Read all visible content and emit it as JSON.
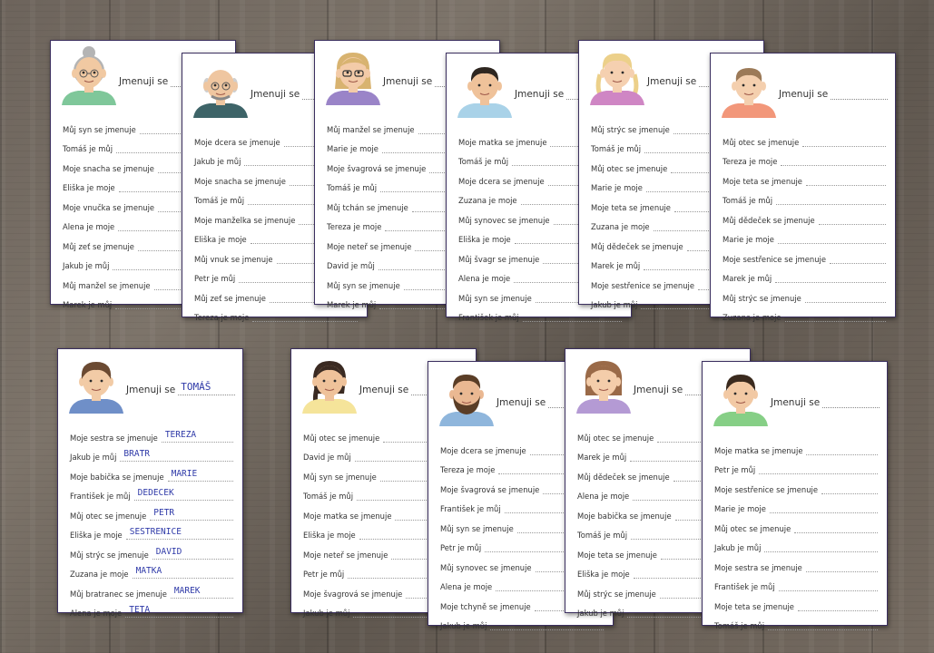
{
  "cards": [
    {
      "person": "grandmother",
      "name_label": "Jmenuji se",
      "name_answer": "",
      "shirt_color": "#7fc79a",
      "hair_color": "#b4b4b4",
      "skin_color": "#f1c9a2",
      "rows": [
        {
          "label": "Můj syn se jmenuje",
          "answer": ""
        },
        {
          "label": "Tomáš je můj",
          "answer": ""
        },
        {
          "label": "Moje snacha se jmenuje",
          "answer": ""
        },
        {
          "label": "Eliška je moje",
          "answer": ""
        },
        {
          "label": "Moje vnučka se jmenuje",
          "answer": ""
        },
        {
          "label": "Alena je moje",
          "answer": ""
        },
        {
          "label": "Můj zeť se jmenuje",
          "answer": ""
        },
        {
          "label": "Jakub je můj",
          "answer": ""
        },
        {
          "label": "Můj manžel se jmenuje",
          "answer": ""
        },
        {
          "label": "Marek je můj",
          "answer": ""
        }
      ]
    },
    {
      "person": "grandfather",
      "name_label": "Jmenuji se",
      "name_answer": "",
      "shirt_color": "#3e6468",
      "hair_color": "#cfcfcf",
      "skin_color": "#efc6a0",
      "rows": [
        {
          "label": "Moje dcera se jmenuje",
          "answer": ""
        },
        {
          "label": "Jakub je můj",
          "answer": ""
        },
        {
          "label": "Moje snacha se jmenuje",
          "answer": ""
        },
        {
          "label": "Tomáš je můj",
          "answer": ""
        },
        {
          "label": "Moje manželka se jmenuje",
          "answer": ""
        },
        {
          "label": "Eliška je moje",
          "answer": ""
        },
        {
          "label": "Můj vnuk se jmenuje",
          "answer": ""
        },
        {
          "label": "Petr je můj",
          "answer": ""
        },
        {
          "label": "Můj zeť se jmenuje",
          "answer": ""
        },
        {
          "label": "Tereza je moje",
          "answer": ""
        }
      ]
    },
    {
      "person": "woman-glasses",
      "name_label": "Jmenuji se",
      "name_answer": "",
      "shirt_color": "#9a84c8",
      "hair_color": "#d8b370",
      "skin_color": "#f3cba8",
      "rows": [
        {
          "label": "Můj manžel se jmenuje",
          "answer": ""
        },
        {
          "label": "Marie je moje",
          "answer": ""
        },
        {
          "label": "Moje švagrová se jmenuje",
          "answer": ""
        },
        {
          "label": "Tomáš je můj",
          "answer": ""
        },
        {
          "label": "Můj tchán se jmenuje",
          "answer": ""
        },
        {
          "label": "Tereza je moje",
          "answer": ""
        },
        {
          "label": "Moje neteř se jmenuje",
          "answer": ""
        },
        {
          "label": "David je můj",
          "answer": ""
        },
        {
          "label": "Můj syn se jmenuje",
          "answer": ""
        },
        {
          "label": "Marek je můj",
          "answer": ""
        }
      ]
    },
    {
      "person": "man-dark-hair",
      "name_label": "Jmenuji se",
      "name_answer": "",
      "shirt_color": "#a9d2e8",
      "hair_color": "#2e2620",
      "skin_color": "#efc29a",
      "rows": [
        {
          "label": "Moje matka se jmenuje",
          "answer": ""
        },
        {
          "label": "Tomáš je můj",
          "answer": ""
        },
        {
          "label": "Moje dcera se jmenuje",
          "answer": ""
        },
        {
          "label": "Zuzana je moje",
          "answer": ""
        },
        {
          "label": "Můj synovec se jmenuje",
          "answer": ""
        },
        {
          "label": "Eliška je moje",
          "answer": ""
        },
        {
          "label": "Můj švagr se jmenuje",
          "answer": ""
        },
        {
          "label": "Alena je moje",
          "answer": ""
        },
        {
          "label": "Můj syn se jmenuje",
          "answer": ""
        },
        {
          "label": "František je můj",
          "answer": ""
        }
      ]
    },
    {
      "person": "girl-pigtails",
      "name_label": "Jmenuji se",
      "name_answer": "",
      "shirt_color": "#cf86c4",
      "hair_color": "#ecd08a",
      "skin_color": "#f5d0b0",
      "rows": [
        {
          "label": "Můj strýc se jmenuje",
          "answer": ""
        },
        {
          "label": "Tomáš je můj",
          "answer": ""
        },
        {
          "label": "Můj otec se jmenuje",
          "answer": ""
        },
        {
          "label": "Marie je moje",
          "answer": ""
        },
        {
          "label": "Moje teta se jmenuje",
          "answer": ""
        },
        {
          "label": "Zuzana je moje",
          "answer": ""
        },
        {
          "label": "Můj dědeček se jmenuje",
          "answer": ""
        },
        {
          "label": "Marek je můj",
          "answer": ""
        },
        {
          "label": "Moje sestřenice se jmenuje",
          "answer": ""
        },
        {
          "label": "Jakub je můj",
          "answer": ""
        }
      ]
    },
    {
      "person": "small-boy",
      "name_label": "Jmenuji se",
      "name_answer": "",
      "shirt_color": "#f2977a",
      "hair_color": "#9c7a58",
      "skin_color": "#f4cfae",
      "rows": [
        {
          "label": "Můj otec se jmenuje",
          "answer": ""
        },
        {
          "label": "Tereza je moje",
          "answer": ""
        },
        {
          "label": "Moje teta se jmenuje",
          "answer": ""
        },
        {
          "label": "Tomáš je můj",
          "answer": ""
        },
        {
          "label": "Můj dědeček se jmenuje",
          "answer": ""
        },
        {
          "label": "Marie je moje",
          "answer": ""
        },
        {
          "label": "Moje sestřenice se jmenuje",
          "answer": ""
        },
        {
          "label": "Marek je můj",
          "answer": ""
        },
        {
          "label": "Můj strýc se jmenuje",
          "answer": ""
        },
        {
          "label": "Zuzana je moje",
          "answer": ""
        }
      ]
    },
    {
      "person": "boy-tomas",
      "name_label": "Jmenuji se",
      "name_answer": "TOMÁŠ",
      "shirt_color": "#6f8fc8",
      "hair_color": "#6b4a32",
      "skin_color": "#f2cba6",
      "rows": [
        {
          "label": "Moje sestra se jmenuje",
          "answer": "TEREZA"
        },
        {
          "label": "Jakub je můj",
          "answer": "BRATR"
        },
        {
          "label": "Moje babička se jmenuje",
          "answer": "MARIE"
        },
        {
          "label": "František je můj",
          "answer": "DĚDEČEK"
        },
        {
          "label": "Můj otec se jmenuje",
          "answer": "PETR"
        },
        {
          "label": "Eliška je moje",
          "answer": "SESTŘENICE"
        },
        {
          "label": "Můj strýc se jmenuje",
          "answer": "DAVID"
        },
        {
          "label": "Zuzana je moje",
          "answer": "MATKA"
        },
        {
          "label": "Můj bratranec se jmenuje",
          "answer": "MAREK"
        },
        {
          "label": "Alena je moje",
          "answer": "TETA"
        }
      ]
    },
    {
      "person": "woman-braid",
      "name_label": "Jmenuji se",
      "name_answer": "",
      "shirt_color": "#f5e49a",
      "hair_color": "#3a2a22",
      "skin_color": "#efc29a",
      "rows": [
        {
          "label": "Můj otec se jmenuje",
          "answer": ""
        },
        {
          "label": "David je můj",
          "answer": ""
        },
        {
          "label": "Můj syn se jmenuje",
          "answer": ""
        },
        {
          "label": "Tomáš je můj",
          "answer": ""
        },
        {
          "label": "Moje matka se jmenuje",
          "answer": ""
        },
        {
          "label": "Eliška je moje",
          "answer": ""
        },
        {
          "label": "Moje neteř se jmenuje",
          "answer": ""
        },
        {
          "label": "Petr je můj",
          "answer": ""
        },
        {
          "label": "Moje švagrová se jmenuje",
          "answer": ""
        },
        {
          "label": "Jakub je můj",
          "answer": ""
        }
      ]
    },
    {
      "person": "bearded-man",
      "name_label": "Jmenuji se",
      "name_answer": "",
      "shirt_color": "#8fb6dc",
      "hair_color": "#5a3d26",
      "skin_color": "#eab892",
      "rows": [
        {
          "label": "Moje dcera se jmenuje",
          "answer": ""
        },
        {
          "label": "Tereza je moje",
          "answer": ""
        },
        {
          "label": "Moje švagrová se jmenuje",
          "answer": ""
        },
        {
          "label": "František je můj",
          "answer": ""
        },
        {
          "label": "Můj syn se jmenuje",
          "answer": ""
        },
        {
          "label": "Petr je můj",
          "answer": ""
        },
        {
          "label": "Můj synovec se jmenuje",
          "answer": ""
        },
        {
          "label": "Alena je moje",
          "answer": ""
        },
        {
          "label": "Moje tchyně se jmenuje",
          "answer": ""
        },
        {
          "label": "Jakub je můj",
          "answer": ""
        }
      ]
    },
    {
      "person": "girl-bob",
      "name_label": "Jmenuji se",
      "name_answer": "",
      "shirt_color": "#b49ad4",
      "hair_color": "#9a6a48",
      "skin_color": "#f4cdaa",
      "rows": [
        {
          "label": "Můj otec se jmenuje",
          "answer": ""
        },
        {
          "label": "Marek je můj",
          "answer": ""
        },
        {
          "label": "Můj dědeček se jmenuje",
          "answer": ""
        },
        {
          "label": "Alena je moje",
          "answer": ""
        },
        {
          "label": "Moje babička se jmenuje",
          "answer": ""
        },
        {
          "label": "Tomáš je můj",
          "answer": ""
        },
        {
          "label": "Moje teta se jmenuje",
          "answer": ""
        },
        {
          "label": "Eliška je moje",
          "answer": ""
        },
        {
          "label": "Můj strýc se jmenuje",
          "answer": ""
        },
        {
          "label": "Jakub je můj",
          "answer": ""
        }
      ]
    },
    {
      "person": "boy-green",
      "name_label": "Jmenuji se",
      "name_answer": "",
      "shirt_color": "#86cf86",
      "hair_color": "#3a2a1e",
      "skin_color": "#f2c9a4",
      "rows": [
        {
          "label": "Moje matka se jmenuje",
          "answer": ""
        },
        {
          "label": "Petr je můj",
          "answer": ""
        },
        {
          "label": "Moje sestřenice se jmenuje",
          "answer": ""
        },
        {
          "label": "Marie je moje",
          "answer": ""
        },
        {
          "label": "Můj otec se jmenuje",
          "answer": ""
        },
        {
          "label": "Jakub je můj",
          "answer": ""
        },
        {
          "label": "Moje sestra se jmenuje",
          "answer": ""
        },
        {
          "label": "František je můj",
          "answer": ""
        },
        {
          "label": "Moje teta se jmenuje",
          "answer": ""
        },
        {
          "label": "Tomáš je můj",
          "answer": ""
        }
      ]
    }
  ]
}
